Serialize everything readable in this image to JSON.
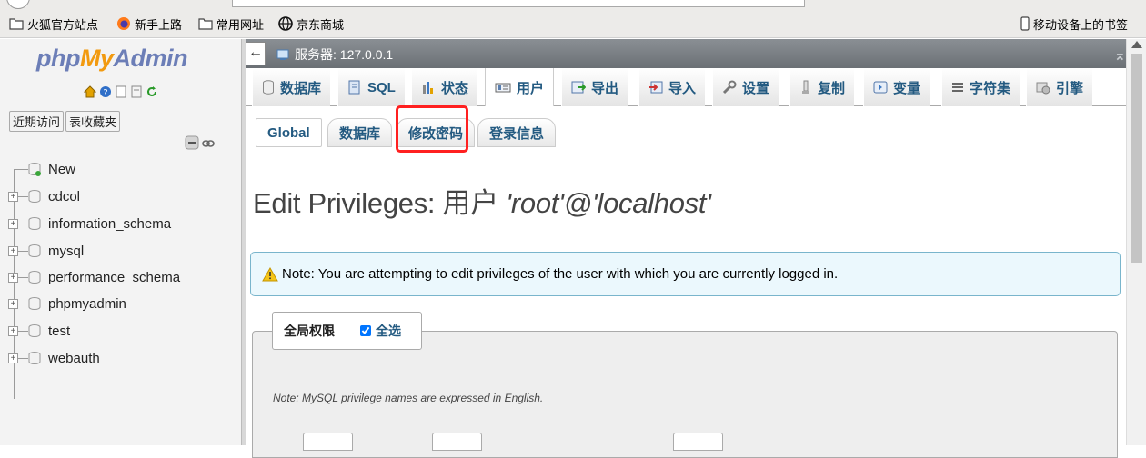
{
  "bookmarks": [
    {
      "label": "火狐官方站点",
      "icon": "folder-icon"
    },
    {
      "label": "新手上路",
      "icon": "firefox-icon"
    },
    {
      "label": "常用网址",
      "icon": "folder-icon"
    },
    {
      "label": "京东商城",
      "icon": "globe-icon"
    }
  ],
  "mobile_bookmarks": "移动设备上的书签",
  "logo": {
    "php": "php",
    "my": "My",
    "admin": "Admin"
  },
  "nav_tabs": [
    "近期访问",
    "表收藏夹"
  ],
  "databases": [
    "New",
    "cdcol",
    "information_schema",
    "mysql",
    "performance_schema",
    "phpmyadmin",
    "test",
    "webauth"
  ],
  "server": {
    "label": "服务器: 127.0.0.1"
  },
  "top_menu": [
    {
      "label": "数据库",
      "icon": "database-icon"
    },
    {
      "label": "SQL",
      "icon": "sql-icon"
    },
    {
      "label": "状态",
      "icon": "status-icon"
    },
    {
      "label": "用户",
      "icon": "users-icon"
    },
    {
      "label": "导出",
      "icon": "export-icon"
    },
    {
      "label": "导入",
      "icon": "import-icon"
    },
    {
      "label": "设置",
      "icon": "wrench-icon"
    },
    {
      "label": "复制",
      "icon": "replication-icon"
    },
    {
      "label": "变量",
      "icon": "variables-icon"
    },
    {
      "label": "字符集",
      "icon": "charset-icon"
    },
    {
      "label": "引擎",
      "icon": "engine-icon"
    }
  ],
  "active_tab": "用户",
  "sub_tabs": [
    "Global",
    "数据库",
    "修改密码",
    "登录信息"
  ],
  "title": {
    "prefix": "Edit Privileges: 用户",
    "user": "'root'@'localhost'"
  },
  "notice": "Note: You are attempting to edit privileges of the user with which you are currently logged in.",
  "privileges": {
    "legend": "全局权限",
    "check_all": "全选",
    "check_all_checked": true
  },
  "privilege_note": "Note: MySQL privilege names are expressed in English.",
  "colors": {
    "accent": "#235a81",
    "highlight": "#ff2020",
    "notice_bg": "#ebf8fd"
  }
}
